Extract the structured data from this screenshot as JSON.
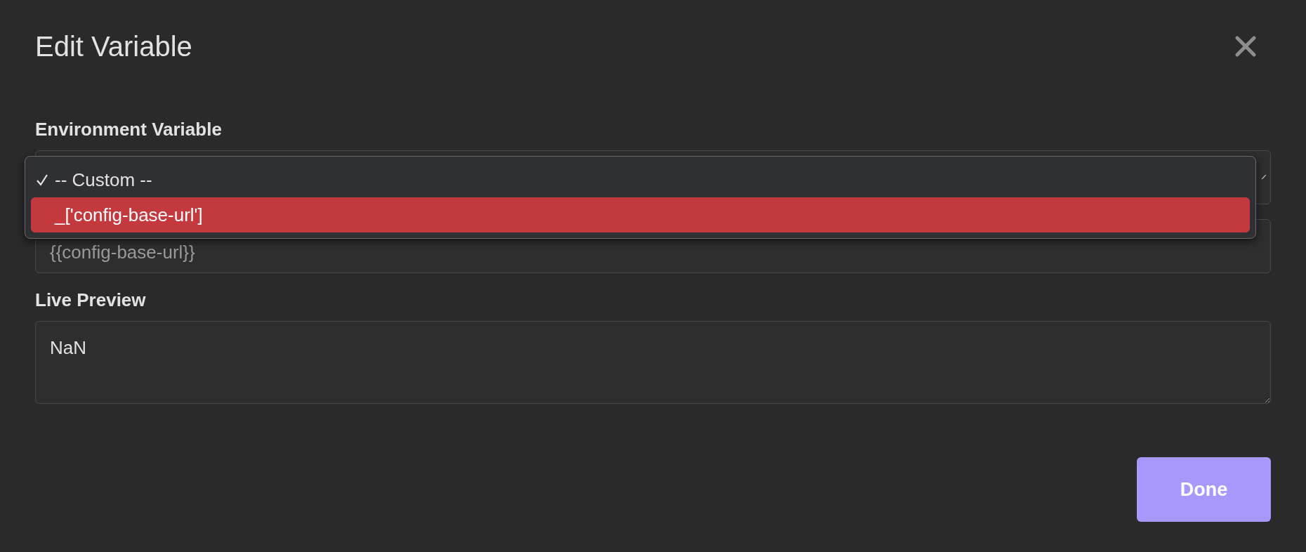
{
  "dialog": {
    "title": "Edit Variable"
  },
  "environment_variable": {
    "label": "Environment Variable",
    "dropdown": {
      "expanded": true,
      "options": [
        {
          "label": "-- Custom --",
          "selected": true,
          "highlighted": false
        },
        {
          "label": "_['config-base-url']",
          "selected": false,
          "highlighted": true
        }
      ]
    }
  },
  "custom_input": {
    "value": "{{config-base-url}}"
  },
  "live_preview": {
    "label": "Live Preview",
    "value": "NaN"
  },
  "buttons": [
    {
      "label": "Done"
    }
  ]
}
